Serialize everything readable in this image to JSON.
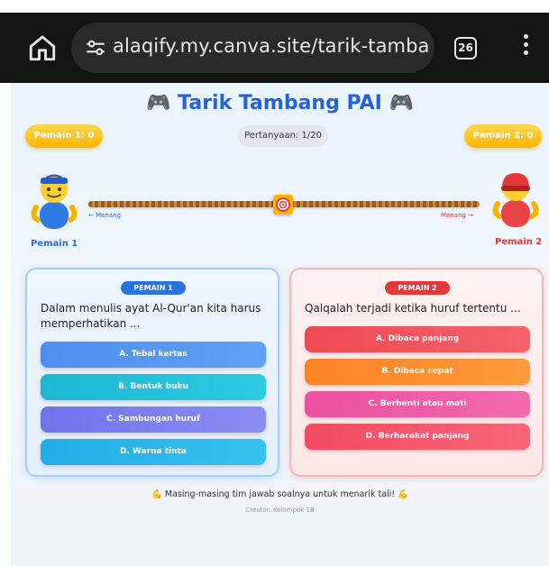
{
  "browser": {
    "url": "alaqify.my.canva.site/tarik-tamba",
    "tab_count": "26"
  },
  "game": {
    "title": "🎮 Tarik Tambang PAI 🎮",
    "score1": "Pemain 1: 0",
    "score2": "Pemain 2: 0",
    "question_counter": "Pertanyaan: 1/20",
    "player1_label": "Pemain 1",
    "player2_label": "Pemain 2",
    "hint_left": "← Menang",
    "hint_right": "Menang →",
    "rope_center_icon": "🎯"
  },
  "cards": {
    "p1": {
      "tag": "PEMAIN 1",
      "question": "Dalam menulis ayat Al-Qur'an kita harus memperhatikan ...",
      "options": [
        "A. Tebal kertas",
        "B. Bentuk buku",
        "C. Sambungan huruf",
        "D. Warna tinta"
      ]
    },
    "p2": {
      "tag": "PEMAIN 2",
      "question": "Qalqalah terjadi ketika huruf tertentu ...",
      "options": [
        "A. Dibaca panjang",
        "B. Dibaca cepat",
        "C. Berhenti atau mati",
        "D. Berharakat panjang"
      ]
    }
  },
  "footer": {
    "message": "💪 Masing-masing tim jawab soalnya untuk menarik tali! 💪",
    "creator": "Creator: Kelompok 1B"
  },
  "colors": {
    "p1_options": [
      "#4d8ef0",
      "#20bcd8",
      "#7b7ef0",
      "#29b6e8"
    ],
    "p2_options": [
      "#f0525a",
      "#fb8a2a",
      "#ee5aa4",
      "#f5566a"
    ],
    "title": "#2563d9"
  },
  "icons": [
    "home-icon",
    "tune-icon",
    "tabs-icon",
    "more-vert-icon",
    "gamepad-icon",
    "target-icon"
  ]
}
